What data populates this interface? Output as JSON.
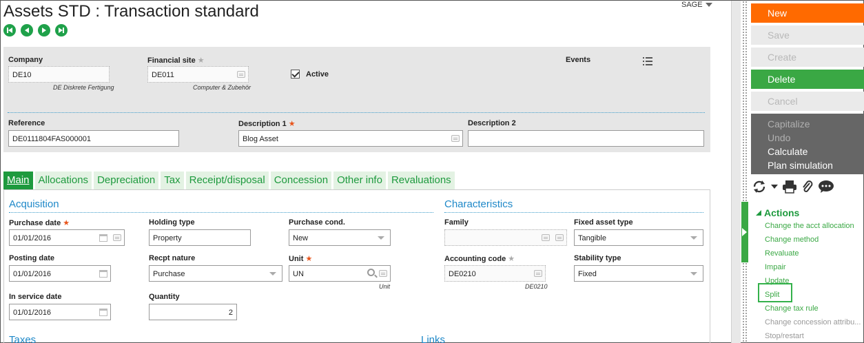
{
  "page": {
    "title": "Assets STD : Transaction standard",
    "user_menu": "SAGE"
  },
  "header": {
    "company": {
      "label": "Company",
      "value": "DE10",
      "description": "DE Diskrete Fertigung"
    },
    "financial_site": {
      "label": "Financial site",
      "star": "★",
      "value": "DE011",
      "description": "Computer & Zubehör"
    },
    "active": {
      "label": "Active",
      "checked": true
    },
    "events": {
      "label": "Events"
    },
    "reference": {
      "label": "Reference",
      "value": "DE0111804FAS000001"
    },
    "description1": {
      "label": "Description 1",
      "star": "★",
      "value": "Blog Asset"
    },
    "description2": {
      "label": "Description 2",
      "value": ""
    }
  },
  "tabs": [
    {
      "label": "Main",
      "active": true
    },
    {
      "label": "Allocations"
    },
    {
      "label": "Depreciation"
    },
    {
      "label": "Tax"
    },
    {
      "label": "Receipt/disposal"
    },
    {
      "label": "Concession"
    },
    {
      "label": "Other info"
    },
    {
      "label": "Revaluations"
    }
  ],
  "acquisition": {
    "title": "Acquisition",
    "purchase_date": {
      "label": "Purchase date",
      "star": "★",
      "value": "01/01/2016"
    },
    "holding_type": {
      "label": "Holding type",
      "value": "Property"
    },
    "purchase_cond": {
      "label": "Purchase cond.",
      "value": "New"
    },
    "posting_date": {
      "label": "Posting date",
      "value": "01/01/2016"
    },
    "recpt_nature": {
      "label": "Recpt nature",
      "value": "Purchase"
    },
    "unit": {
      "label": "Unit",
      "star": "★",
      "value": "UN",
      "description": "Unit"
    },
    "in_service_date": {
      "label": "In service date",
      "value": "01/01/2016"
    },
    "quantity": {
      "label": "Quantity",
      "value": "2"
    }
  },
  "characteristics": {
    "title": "Characteristics",
    "family": {
      "label": "Family",
      "value": ""
    },
    "fixed_asset_type": {
      "label": "Fixed asset type",
      "value": "Tangible"
    },
    "accounting_code": {
      "label": "Accounting code",
      "star": "★",
      "value": "DE0210",
      "description": "DE0210"
    },
    "stability_type": {
      "label": "Stability type",
      "value": "Fixed"
    }
  },
  "bottom_sections": {
    "taxes": "Taxes",
    "links": "Links"
  },
  "sidebar": {
    "buttons": {
      "new": "New",
      "save": "Save",
      "create": "Create",
      "delete": "Delete",
      "cancel": "Cancel"
    },
    "grey_menu": {
      "capitalize": "Capitalize",
      "undo": "Undo",
      "calculate": "Calculate",
      "plan_simulation": "Plan simulation"
    },
    "actions_title": "Actions",
    "actions": [
      "Change the acct allocation",
      "Change method",
      "Revaluate",
      "Impair",
      "Update",
      "Split",
      "Change tax rule",
      "Change concession attribu...",
      "Stop/restart"
    ]
  },
  "colors": {
    "accent_green": "#1e9a3e",
    "orange": "#ff6a00",
    "link_blue": "#1e88c8",
    "required_star": "#e8541b"
  }
}
